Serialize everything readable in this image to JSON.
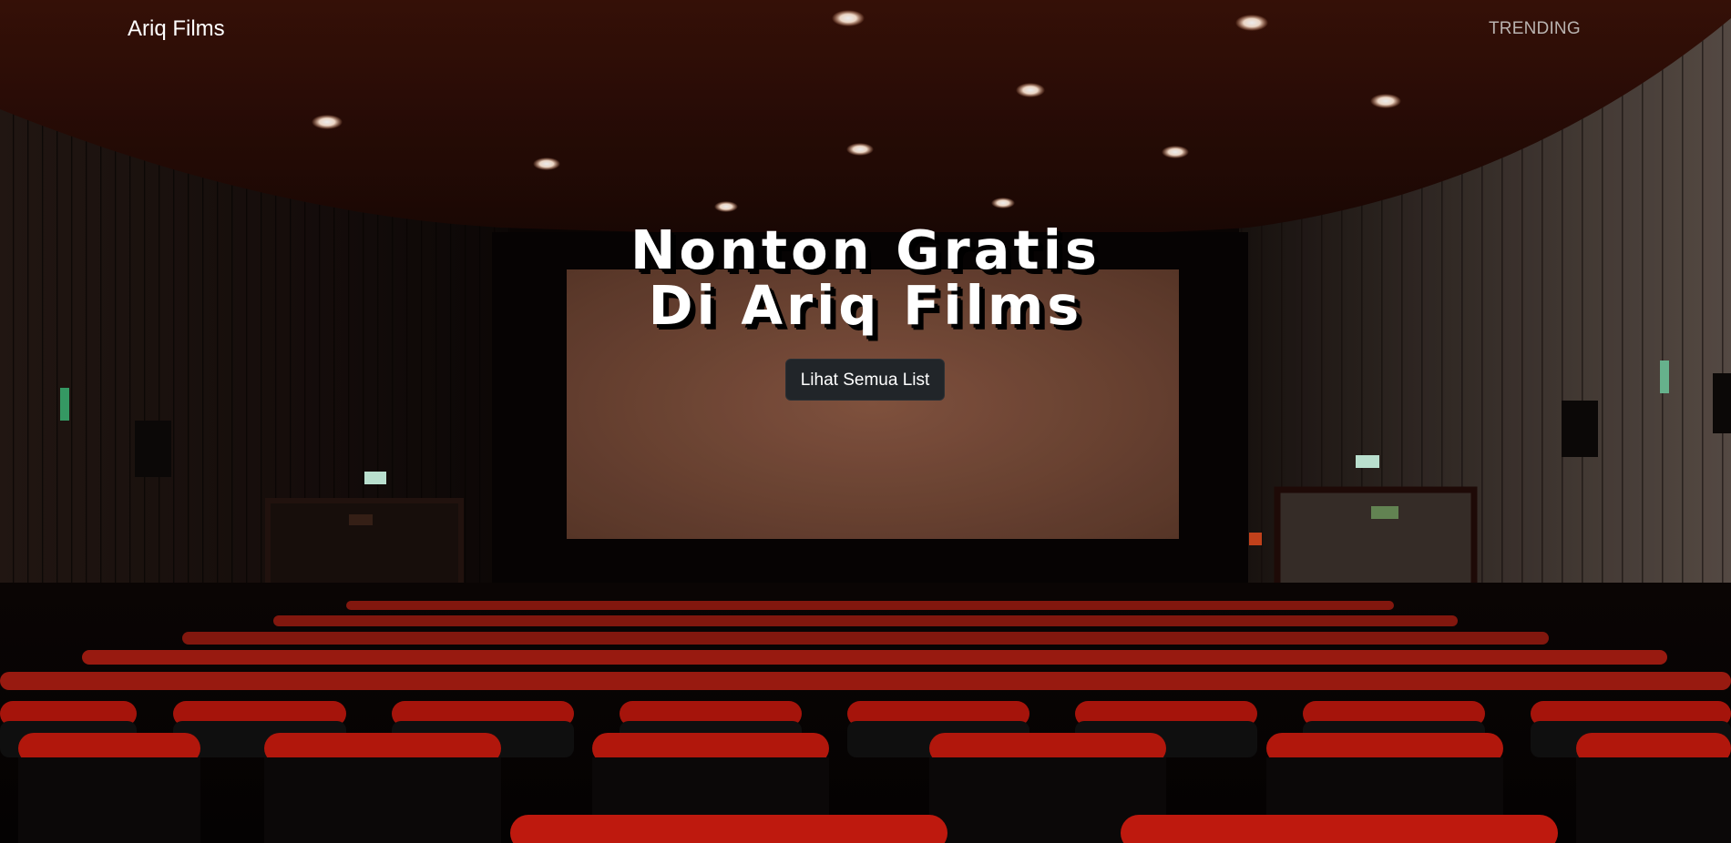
{
  "navbar": {
    "brand": "Ariq Films",
    "links": [
      {
        "label": "TRENDING"
      }
    ]
  },
  "hero": {
    "headline_line1": "Nonton Gratis",
    "headline_line2": "Di Ariq Films",
    "cta_label": "Lihat Semua List",
    "background": "cinema-hall-photo"
  },
  "colors": {
    "brand_text": "#ffffff",
    "nav_link": "#b9b3b0",
    "button_bg": "#212529",
    "seat_red": "#b3160c",
    "screen": "#7a4a38"
  }
}
